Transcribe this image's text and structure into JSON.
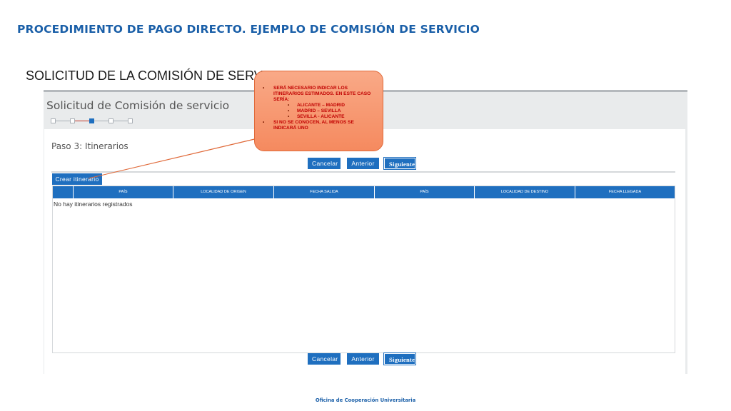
{
  "slide": {
    "title": "PROCEDIMIENTO DE PAGO DIRECTO. EJEMPLO DE COMISIÓN DE SERVICIO",
    "section_title": "SOLICITUD DE LA COMISIÓN DE SERVICIO",
    "footer": "Oficina de Cooperación Universitaria"
  },
  "app": {
    "title": "Solicitud de Comisión de servicio",
    "steps": {
      "total": 5,
      "current": 3
    },
    "step_title": "Paso 3: Itinerarios",
    "buttons": {
      "cancel": "Cancelar",
      "previous": "Anterior",
      "next": "Siguiente",
      "create_itinerary": "Crear itinerario"
    },
    "table": {
      "columns": [
        "",
        "PAÍS",
        "LOCALIDAD DE ORIGEN",
        "FECHA SALIDA",
        "PAÍS",
        "LOCALIDAD DE DESTINO",
        "FECHA LLEGADA"
      ],
      "empty_message": "No hay itinerarios registrados"
    }
  },
  "callout": {
    "item1": "SERÁ NECESARIO INDICAR LOS ITINERARIOS ESTIMADOS. EN ESTE CASO SERÍA:",
    "routes": [
      "ALICANTE – MADRID",
      "MADRID – SEVILLA",
      "SEVILLA - ALICANTE"
    ],
    "item2": "SI NO SE CONOCEN, AL MENOS SE INDICARÁ UNO"
  },
  "colors": {
    "primary_blue": "#1f6fbf",
    "title_blue": "#1a5fa8",
    "callout_fill": "#f58a5f",
    "callout_text": "#c00000"
  }
}
